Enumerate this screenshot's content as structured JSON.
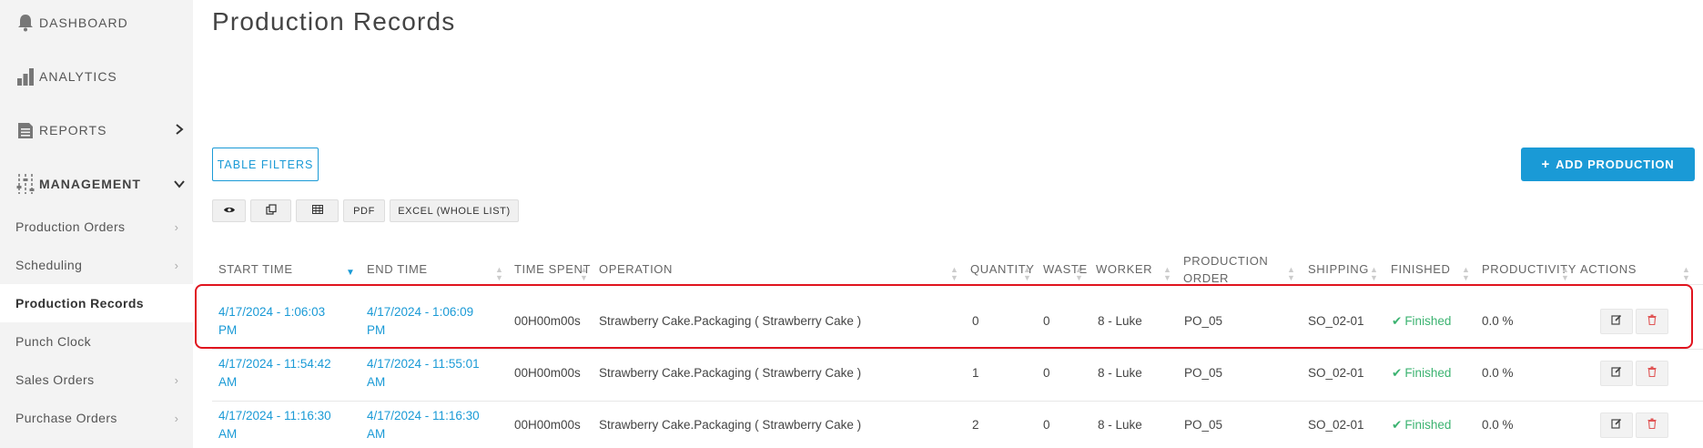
{
  "sidebar": {
    "dashboard": "DASHBOARD",
    "analytics": "ANALYTICS",
    "reports": "REPORTS",
    "management": "MANAGEMENT",
    "items": [
      {
        "label": "Production Orders"
      },
      {
        "label": "Scheduling"
      },
      {
        "label": "Production Records"
      },
      {
        "label": "Punch Clock"
      },
      {
        "label": "Sales Orders"
      },
      {
        "label": "Purchase Orders"
      }
    ]
  },
  "page": {
    "title": "Production Records",
    "filters_label": "TABLE FILTERS",
    "add_label": "ADD PRODUCTION",
    "pdf_label": "PDF",
    "excel_label": "EXCEL (WHOLE LIST)"
  },
  "table": {
    "headers": {
      "start": "START TIME",
      "end": "END TIME",
      "spent": "TIME SPENT",
      "operation": "OPERATION",
      "quantity": "QUANTITY",
      "waste": "WASTE",
      "worker": "WORKER",
      "order1": "PRODUCTION",
      "order2": "ORDER",
      "shipping": "SHIPPING",
      "finished": "FINISHED",
      "productivity": "PRODUCTIVITY",
      "actions": "ACTIONS"
    },
    "rows": [
      {
        "start1": "4/17/2024 - 1:06:03",
        "start2": "PM",
        "end1": "4/17/2024 - 1:06:09",
        "end2": "PM",
        "spent": "00H00m00s",
        "operation": "Strawberry Cake.Packaging ( Strawberry Cake )",
        "quantity": "0",
        "waste": "0",
        "worker": "8 - Luke",
        "order": "PO_05",
        "shipping": "SO_02-01",
        "finished": "Finished",
        "productivity": "0.0 %"
      },
      {
        "start1": "4/17/2024 - 11:54:42",
        "start2": "AM",
        "end1": "4/17/2024 - 11:55:01",
        "end2": "AM",
        "spent": "00H00m00s",
        "operation": "Strawberry Cake.Packaging ( Strawberry Cake )",
        "quantity": "1",
        "waste": "0",
        "worker": "8 - Luke",
        "order": "PO_05",
        "shipping": "SO_02-01",
        "finished": "Finished",
        "productivity": "0.0 %"
      },
      {
        "start1": "4/17/2024 - 11:16:30",
        "start2": "AM",
        "end1": "4/17/2024 - 11:16:30",
        "end2": "AM",
        "spent": "00H00m00s",
        "operation": "Strawberry Cake.Packaging ( Strawberry Cake )",
        "quantity": "2",
        "waste": "0",
        "worker": "8 - Luke",
        "order": "PO_05",
        "shipping": "SO_02-01",
        "finished": "Finished",
        "productivity": "0.0 %"
      }
    ]
  },
  "icons": {
    "dashboard": "bell-icon",
    "analytics": "bar-chart-icon",
    "reports": "document-icon",
    "management": "sliders-icon",
    "view": "eye-icon",
    "copy": "copy-icon",
    "csv": "table-icon",
    "edit": "edit-icon",
    "delete": "trash-icon"
  },
  "colors": {
    "accent": "#1a9ad6",
    "finished": "#3cb371",
    "delete": "#e05555",
    "highlight": "#e0141e"
  }
}
